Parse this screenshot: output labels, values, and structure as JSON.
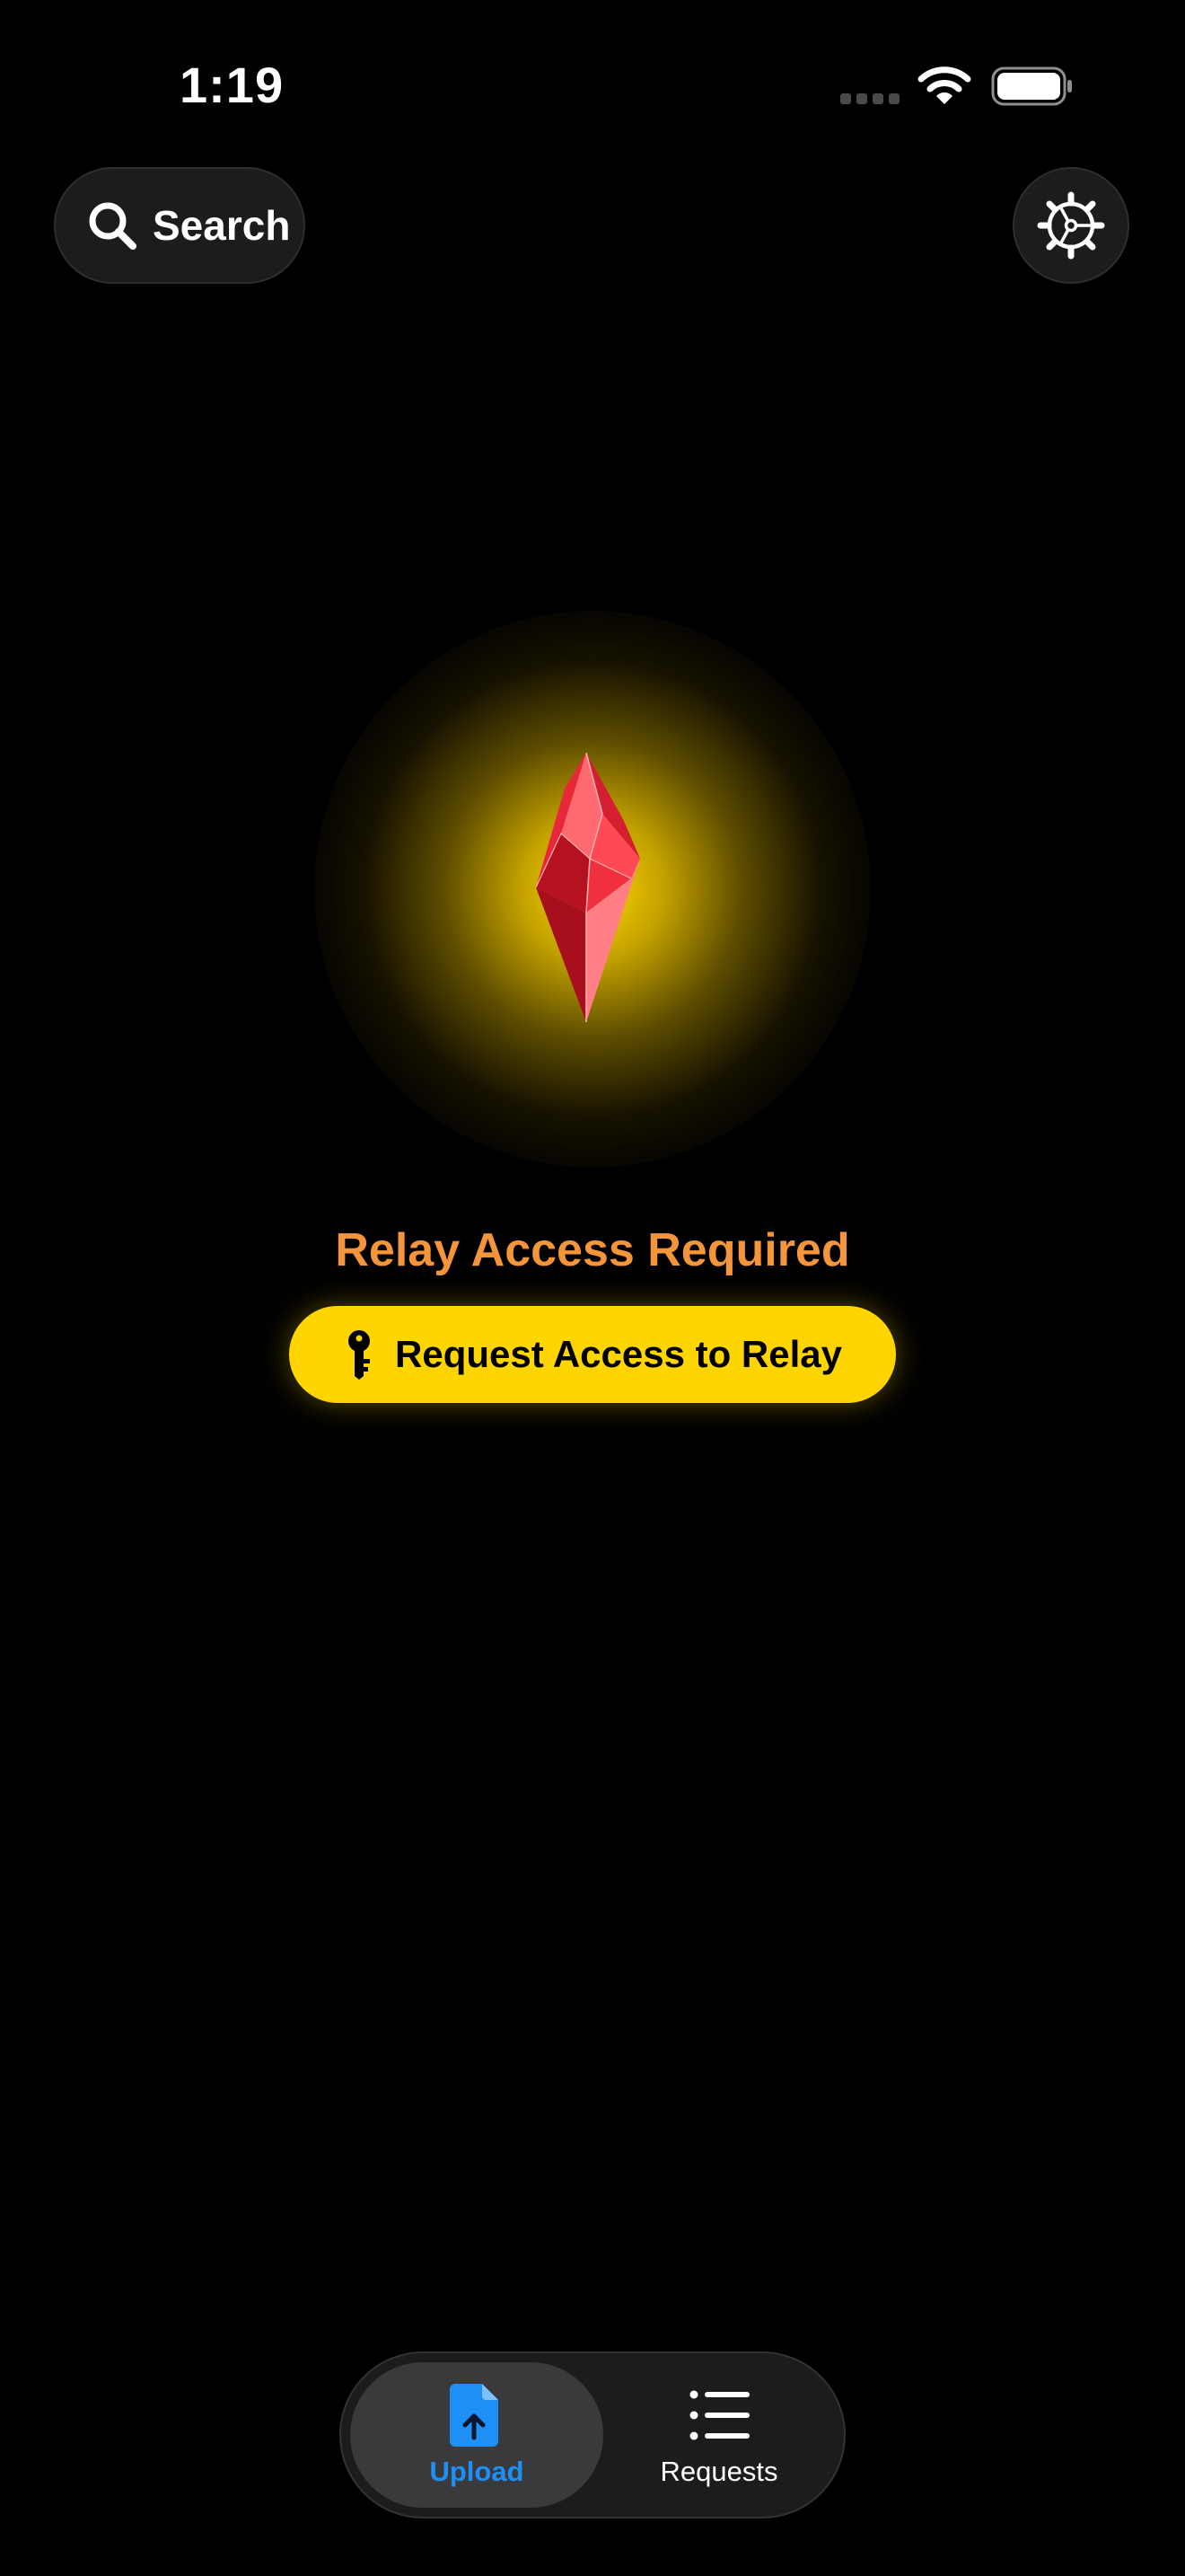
{
  "status_bar": {
    "time": "1:19",
    "icons": [
      "cellular-signal-icon",
      "wifi-icon",
      "battery-icon"
    ]
  },
  "header": {
    "search_label": "Search",
    "search_icon": "magnifying-glass-icon",
    "settings_icon": "gear-icon"
  },
  "hero": {
    "image": "red-crystal",
    "title": "Relay Access Required",
    "button_label": "Request Access to Relay",
    "button_icon": "key-icon"
  },
  "tab_bar": {
    "tabs": [
      {
        "label": "Upload",
        "icon": "document-upload-icon",
        "selected": true
      },
      {
        "label": "Requests",
        "icon": "list-icon",
        "selected": false
      }
    ]
  },
  "colors": {
    "background": "#000000",
    "title_orange": "#f4953a",
    "button_yellow": "#ffd500",
    "glow_yellow": "#ffd600",
    "crystal_red": "#e8283a",
    "tab_selected_blue": "#1e8ff5",
    "control_gray": "#1c1c1e"
  }
}
